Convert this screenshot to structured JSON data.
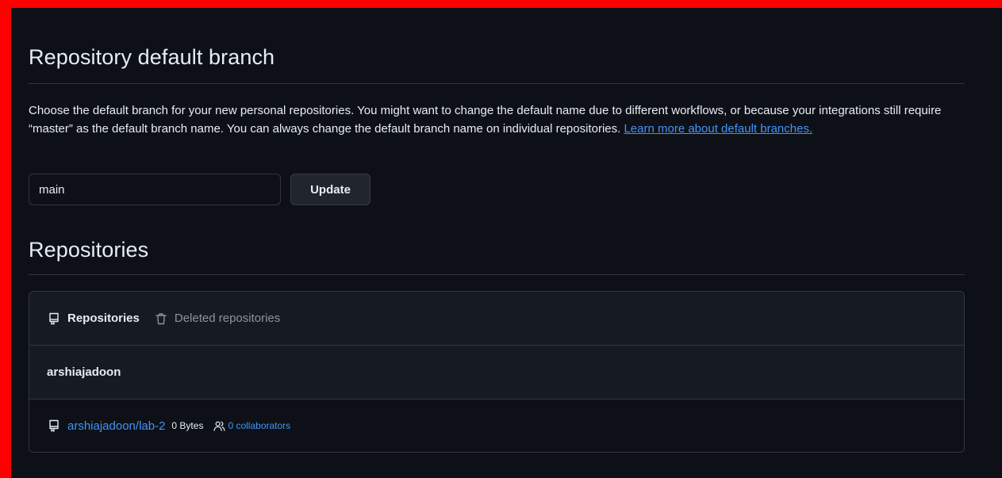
{
  "default_branch": {
    "title": "Repository default branch",
    "description": "Choose the default branch for your new personal repositories. You might want to change the default name due to different workflows, or because your integrations still require “master” as the default branch name. You can always change the default branch name on individual repositories.",
    "learn_more_label": "Learn more about default branches.",
    "input_value": "main",
    "update_label": "Update"
  },
  "repositories": {
    "title": "Repositories",
    "tabs": [
      {
        "label": "Repositories",
        "icon": "repo-icon",
        "active": true
      },
      {
        "label": "Deleted repositories",
        "icon": "trash-icon",
        "active": false
      }
    ],
    "owner": "arshiajadoon",
    "items": [
      {
        "name": "arshiajadoon/lab-2",
        "size": "0 Bytes",
        "collaborators": "0 collaborators",
        "icon": "repo-icon"
      }
    ]
  },
  "colors": {
    "background": "#0d1117",
    "surface": "#161b22",
    "border": "#30363d",
    "text": "#e6edf3",
    "muted": "#8b949e",
    "link": "#4493f8",
    "frame": "#ff0000"
  }
}
